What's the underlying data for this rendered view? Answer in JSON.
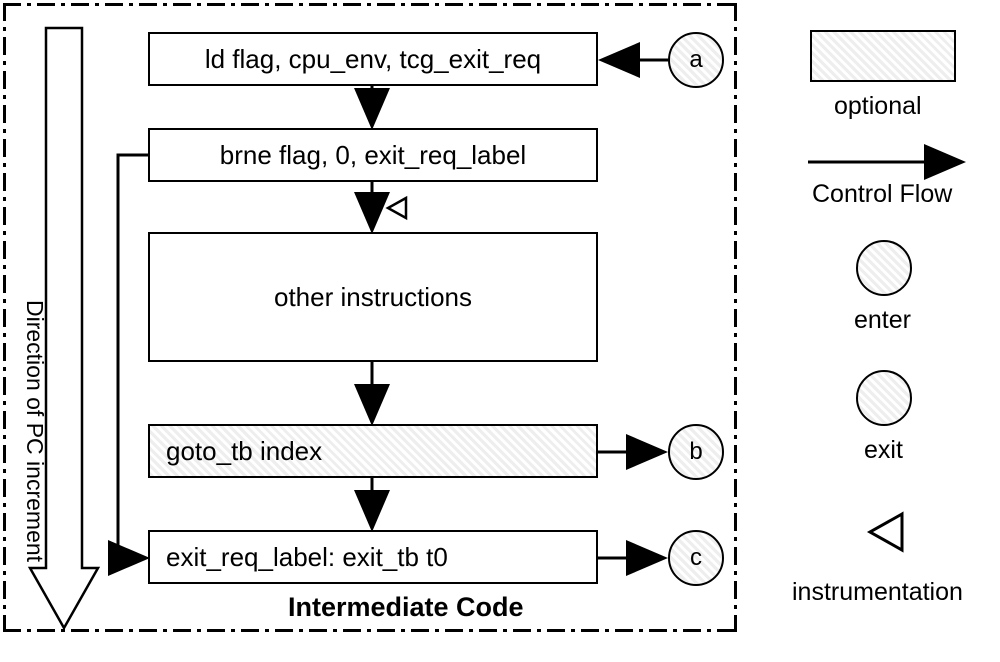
{
  "diagram": {
    "title": "Intermediate Code",
    "side_label": "Direction of PC increment",
    "nodes": {
      "n1": "ld flag, cpu_env, tcg_exit_req",
      "n2": "brne  flag, 0, exit_req_label",
      "n3": "other instructions",
      "n4": "goto_tb index",
      "n5": "exit_req_label: exit_tb t0"
    },
    "circles": {
      "a": "a",
      "b": "b",
      "c": "c"
    }
  },
  "legend": {
    "optional": "optional",
    "control_flow": "Control Flow",
    "enter": "enter",
    "exit": "exit",
    "instrumentation": "instrumentation"
  }
}
